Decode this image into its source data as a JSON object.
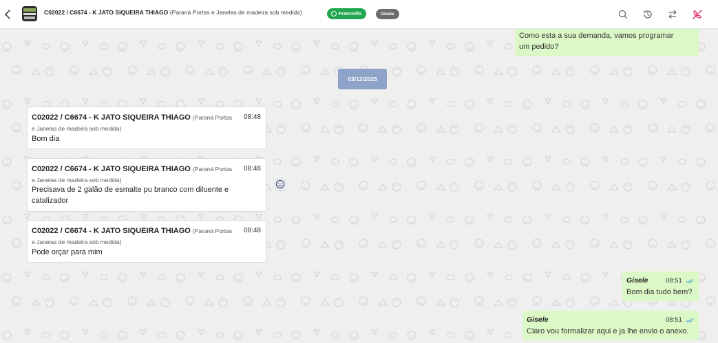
{
  "header": {
    "title": "C02022 / C6674 - K JATO SIQUEIRA THIAGO",
    "subtitle": "(Paraná Portas e Janelas de madeira sob medida)",
    "agent_badge": "Franciello",
    "user_badge": "Gisele",
    "icons": [
      "back-icon",
      "search-icon",
      "history-icon",
      "transfer-icon",
      "end-chat-icon"
    ],
    "accent_color": "#1fa64f",
    "danger_color": "#e0245e"
  },
  "messages": {
    "top_out": {
      "text_line1": "Como esta a sua demanda, vamos programar",
      "text_line2": "um pedido?"
    },
    "date": "03/12/2025",
    "incoming": [
      {
        "sender": "C02022 / C6674 - K JATO SIQUEIRA THIAGO",
        "sender_sub_a": "(Paraná Portas",
        "sender_sub_b": "e Janelas de madeira sob medida)",
        "time": "08:48",
        "line1": "Bom dia",
        "line2": ""
      },
      {
        "sender": "C02022 / C6674 - K JATO SIQUEIRA THIAGO",
        "sender_sub_a": "(Paraná Portas",
        "sender_sub_b": "e Janelas de madeira sob medida)",
        "time": "08:48",
        "line1": "Precisava de 2 galão de esmalte pu branco com diluente e",
        "line2": "catalizador"
      },
      {
        "sender": "C02022 / C6674 - K JATO SIQUEIRA THIAGO",
        "sender_sub_a": "(Paraná Portas",
        "sender_sub_b": "e Janelas de madeira sob medida)",
        "time": "08:48",
        "line1": "Pode orçar para mim",
        "line2": ""
      }
    ],
    "outgoing": [
      {
        "agent": "Gisele",
        "time": "08:51",
        "text": "Bom dia tudo bem?"
      },
      {
        "agent": "Gisele",
        "time": "08:51",
        "text": "Claro vou formalizar aqui e ja lhe envio o anexo."
      }
    ]
  }
}
